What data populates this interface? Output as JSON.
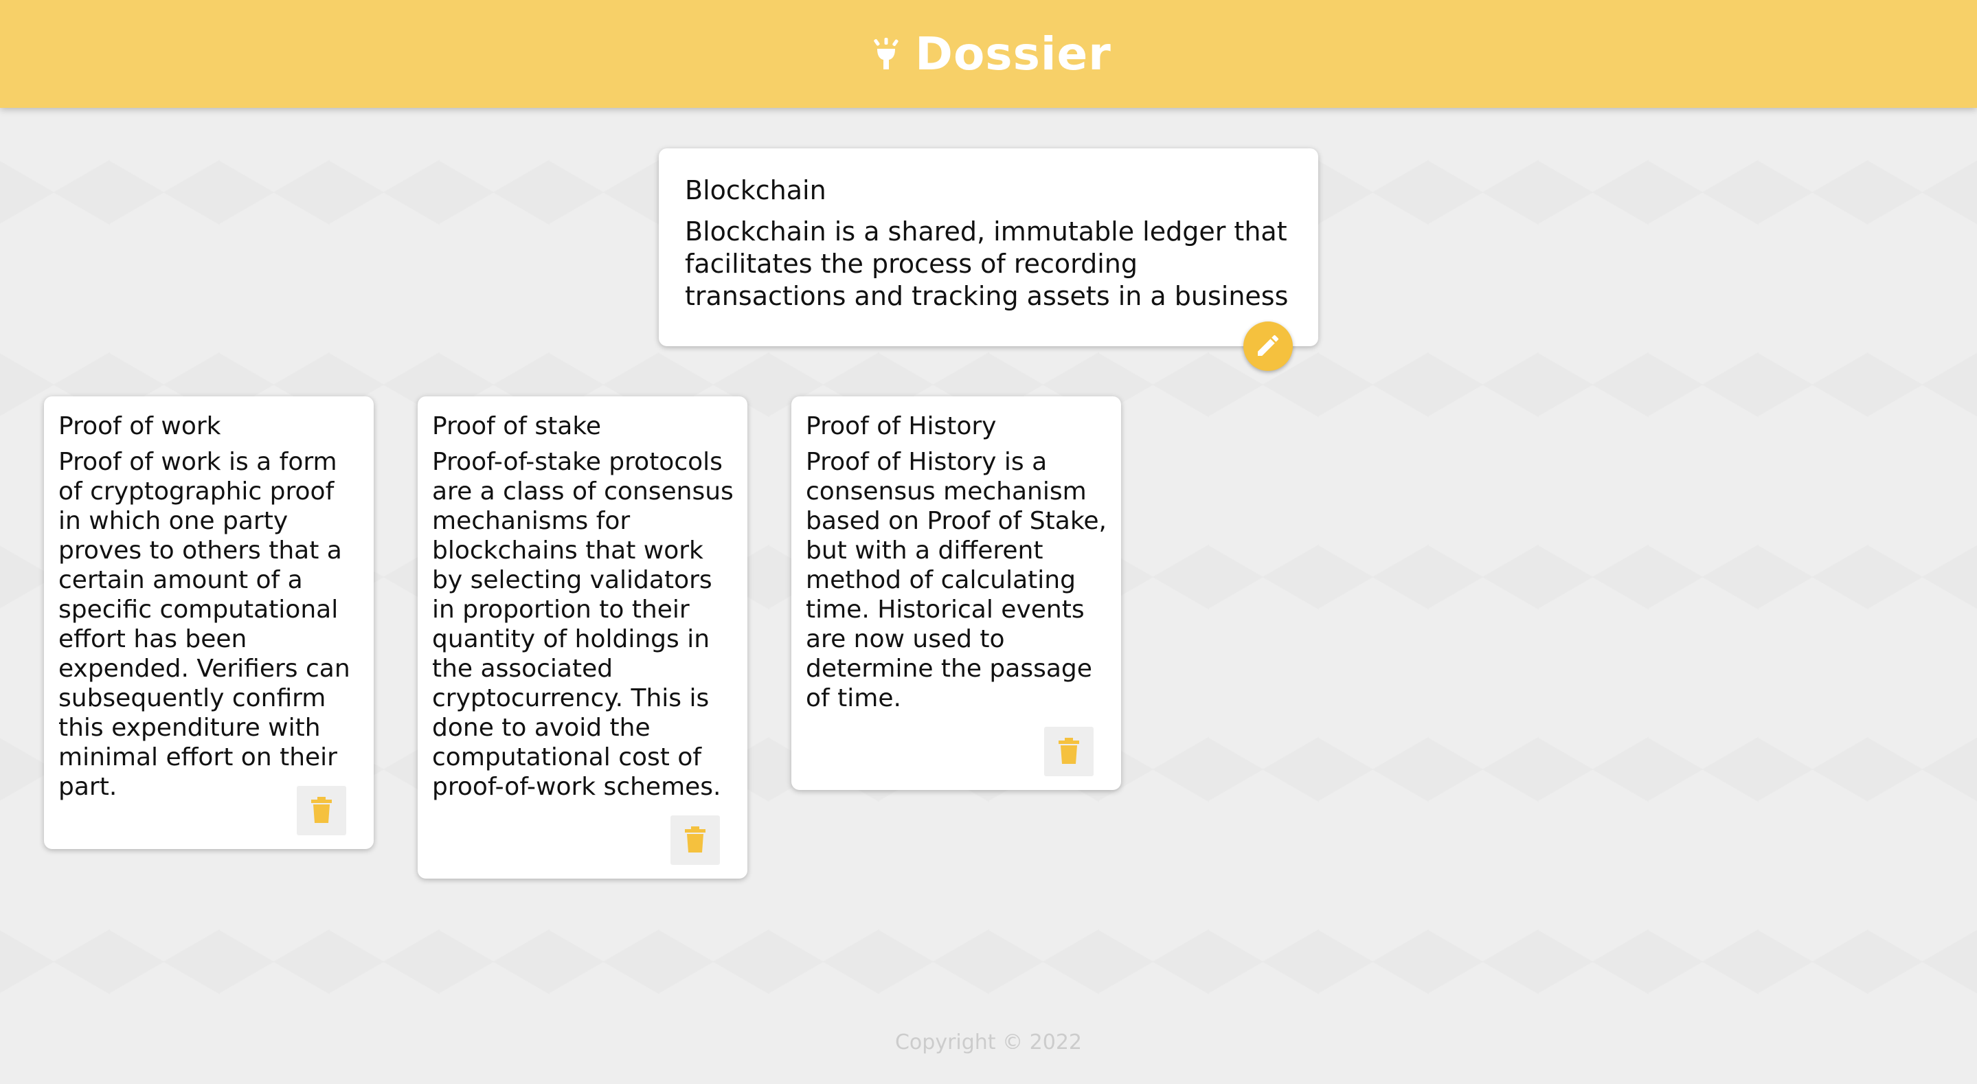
{
  "app": {
    "title": "Dossier",
    "icon": "lightbulb-icon",
    "accent_color": "#f7d068",
    "button_color": "#f5c13e"
  },
  "create_note": {
    "title": "Blockchain",
    "content": "Blockchain is a shared, immutable ledger that facilitates the process of recording transactions and tracking assets in a business",
    "edit_icon": "pencil-icon"
  },
  "notes": [
    {
      "title": "Proof of work",
      "content": "Proof of work is a form of cryptographic proof in which one party proves to others that a certain amount of a specific computational effort has been expended. Verifiers can subsequently confirm this expenditure with minimal effort on their part.",
      "delete_icon": "trash-icon"
    },
    {
      "title": "Proof of stake",
      "content": "Proof-of-stake protocols are a class of consensus mechanisms for blockchains that work by selecting validators in proportion to their quantity of holdings in the associated cryptocurrency. This is done to avoid the computational cost of proof-of-work schemes.",
      "delete_icon": "trash-icon"
    },
    {
      "title": "Proof of History",
      "content": "Proof of History is a consensus mechanism based on Proof of Stake, but with a different method of calculating time. Historical events are now used to determine the passage of time.",
      "delete_icon": "trash-icon"
    }
  ],
  "footer": {
    "copyright": "Copyright © 2022"
  }
}
